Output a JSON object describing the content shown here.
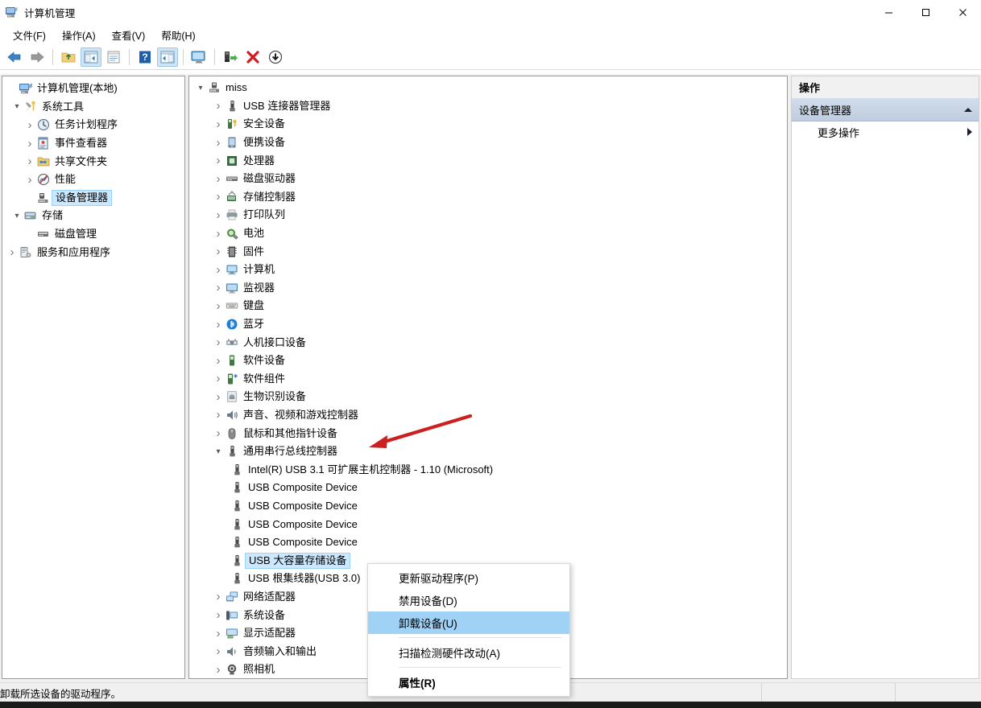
{
  "window": {
    "title": "计算机管理",
    "icon": "computer-management-icon",
    "minimize": "—",
    "maximize": "□",
    "close": "✕"
  },
  "menubar": [
    {
      "label": "文件(F)",
      "name": "menu-file"
    },
    {
      "label": "操作(A)",
      "name": "menu-action"
    },
    {
      "label": "查看(V)",
      "name": "menu-view"
    },
    {
      "label": "帮助(H)",
      "name": "menu-help"
    }
  ],
  "toolbar": [
    {
      "name": "back-icon",
      "glyph": "←"
    },
    {
      "name": "forward-icon",
      "glyph": "→"
    },
    {
      "name": "separator-1",
      "glyph": ""
    },
    {
      "name": "up-one-level-icon",
      "glyph": "↑"
    },
    {
      "name": "show-hide-console-tree-icon",
      "glyph": "▤"
    },
    {
      "name": "properties-icon",
      "glyph": "▤"
    },
    {
      "name": "separator-2",
      "glyph": ""
    },
    {
      "name": "help-icon",
      "glyph": "?"
    },
    {
      "name": "show-hide-action-pane-icon",
      "glyph": "▤"
    },
    {
      "name": "separator-3",
      "glyph": ""
    },
    {
      "name": "scan-hardware-changes-icon",
      "glyph": "Ὓ3"
    },
    {
      "name": "separator-4",
      "glyph": ""
    },
    {
      "name": "update-driver-icon",
      "glyph": "⬇"
    },
    {
      "name": "uninstall-device-icon",
      "glyph": "✕"
    },
    {
      "name": "disable-device-icon",
      "glyph": "⬇"
    }
  ],
  "console_tree": {
    "root": {
      "label": "计算机管理(本地)",
      "icon": "computer-management-icon",
      "expander": "none",
      "indent": 0
    },
    "items": [
      {
        "label": "系统工具",
        "icon": "system-tools-icon",
        "expander": "open",
        "indent": 1
      },
      {
        "label": "任务计划程序",
        "icon": "task-scheduler-icon",
        "expander": "closed",
        "indent": 2
      },
      {
        "label": "事件查看器",
        "icon": "event-viewer-icon",
        "expander": "closed",
        "indent": 2
      },
      {
        "label": "共享文件夹",
        "icon": "shared-folders-icon",
        "expander": "closed",
        "indent": 2
      },
      {
        "label": "性能",
        "icon": "performance-icon",
        "expander": "closed",
        "indent": 2
      },
      {
        "label": "设备管理器",
        "icon": "device-manager-icon",
        "expander": "none",
        "indent": 2,
        "selected": true
      },
      {
        "label": "存储",
        "icon": "storage-icon",
        "expander": "open",
        "indent": 1
      },
      {
        "label": "磁盘管理",
        "icon": "disk-management-icon",
        "expander": "none",
        "indent": 2
      },
      {
        "label": "服务和应用程序",
        "icon": "services-and-applications-icon",
        "expander": "closed",
        "indent": 1
      }
    ]
  },
  "device_tree": {
    "root": {
      "label": "miss",
      "icon": "computer-root-icon",
      "expander": "open"
    },
    "items": [
      {
        "label": "USB 连接器管理器",
        "icon": "usb-icon",
        "expander": "closed",
        "indent": 1
      },
      {
        "label": "安全设备",
        "icon": "security-device-icon",
        "expander": "closed",
        "indent": 1
      },
      {
        "label": "便携设备",
        "icon": "portable-device-icon",
        "expander": "closed",
        "indent": 1
      },
      {
        "label": "处理器",
        "icon": "processor-icon",
        "expander": "closed",
        "indent": 1
      },
      {
        "label": "磁盘驱动器",
        "icon": "disk-drive-icon",
        "expander": "closed",
        "indent": 1
      },
      {
        "label": "存储控制器",
        "icon": "storage-controller-icon",
        "expander": "closed",
        "indent": 1
      },
      {
        "label": "打印队列",
        "icon": "print-queue-icon",
        "expander": "closed",
        "indent": 1
      },
      {
        "label": "电池",
        "icon": "battery-icon",
        "expander": "closed",
        "indent": 1
      },
      {
        "label": "固件",
        "icon": "firmware-icon",
        "expander": "closed",
        "indent": 1
      },
      {
        "label": "计算机",
        "icon": "computer-icon",
        "expander": "closed",
        "indent": 1
      },
      {
        "label": "监视器",
        "icon": "monitor-icon",
        "expander": "closed",
        "indent": 1
      },
      {
        "label": "键盘",
        "icon": "keyboard-icon",
        "expander": "closed",
        "indent": 1
      },
      {
        "label": "蓝牙",
        "icon": "bluetooth-icon",
        "expander": "closed",
        "indent": 1
      },
      {
        "label": "人机接口设备",
        "icon": "hid-icon",
        "expander": "closed",
        "indent": 1
      },
      {
        "label": "软件设备",
        "icon": "software-device-icon",
        "expander": "closed",
        "indent": 1
      },
      {
        "label": "软件组件",
        "icon": "software-component-icon",
        "expander": "closed",
        "indent": 1
      },
      {
        "label": "生物识别设备",
        "icon": "biometric-device-icon",
        "expander": "closed",
        "indent": 1
      },
      {
        "label": "声音、视频和游戏控制器",
        "icon": "sound-video-game-icon",
        "expander": "closed",
        "indent": 1
      },
      {
        "label": "鼠标和其他指针设备",
        "icon": "mouse-icon",
        "expander": "closed",
        "indent": 1
      },
      {
        "label": "通用串行总线控制器",
        "icon": "usb-controller-icon",
        "expander": "open",
        "indent": 1
      },
      {
        "label": "Intel(R) USB 3.1 可扩展主机控制器 - 1.10 (Microsoft)",
        "icon": "usb-icon",
        "expander": "none",
        "indent": 2
      },
      {
        "label": "USB Composite Device",
        "icon": "usb-icon",
        "expander": "none",
        "indent": 2
      },
      {
        "label": "USB Composite Device",
        "icon": "usb-icon",
        "expander": "none",
        "indent": 2
      },
      {
        "label": "USB Composite Device",
        "icon": "usb-icon",
        "expander": "none",
        "indent": 2
      },
      {
        "label": "USB Composite Device",
        "icon": "usb-icon",
        "expander": "none",
        "indent": 2
      },
      {
        "label": "USB 大容量存储设备",
        "icon": "usb-icon",
        "expander": "none",
        "indent": 2,
        "selected": true
      },
      {
        "label": "USB 根集线器(USB 3.0)",
        "icon": "usb-icon",
        "expander": "none",
        "indent": 2
      },
      {
        "label": "网络适配器",
        "icon": "network-adapter-icon",
        "expander": "closed",
        "indent": 1
      },
      {
        "label": "系统设备",
        "icon": "system-device-icon",
        "expander": "closed",
        "indent": 1
      },
      {
        "label": "显示适配器",
        "icon": "display-adapter-icon",
        "expander": "closed",
        "indent": 1
      },
      {
        "label": "音频输入和输出",
        "icon": "audio-io-icon",
        "expander": "closed",
        "indent": 1
      },
      {
        "label": "照相机",
        "icon": "camera-icon",
        "expander": "closed",
        "indent": 1
      }
    ]
  },
  "actions_pane": {
    "header": "操作",
    "group": {
      "label": "设备管理器",
      "collapse_icon": "triangle-up-icon"
    },
    "items": [
      {
        "label": "更多操作",
        "submenu_icon": "triangle-right-icon"
      }
    ]
  },
  "context_menu": {
    "items": [
      {
        "label": "更新驱动程序(P)",
        "name": "ctx-update-driver",
        "highlighted": false,
        "bold": false
      },
      {
        "label": "禁用设备(D)",
        "name": "ctx-disable-device",
        "highlighted": false,
        "bold": false
      },
      {
        "label": "卸载设备(U)",
        "name": "ctx-uninstall-device",
        "highlighted": true,
        "bold": false
      },
      {
        "separator": true
      },
      {
        "label": "扫描检测硬件改动(A)",
        "name": "ctx-scan-hardware-changes",
        "highlighted": false,
        "bold": false
      },
      {
        "separator": true
      },
      {
        "label": "属性(R)",
        "name": "ctx-properties",
        "highlighted": false,
        "bold": true
      }
    ]
  },
  "statusbar": {
    "message": "卸载所选设备的驱动程序。",
    "cell2": "",
    "cell3": ""
  },
  "colors": {
    "selection": "#cce8ff",
    "menu_highlight": "#9fd2f5",
    "action_group": "#c9d6e5",
    "annotation_arrow": "#cc1f1f"
  }
}
